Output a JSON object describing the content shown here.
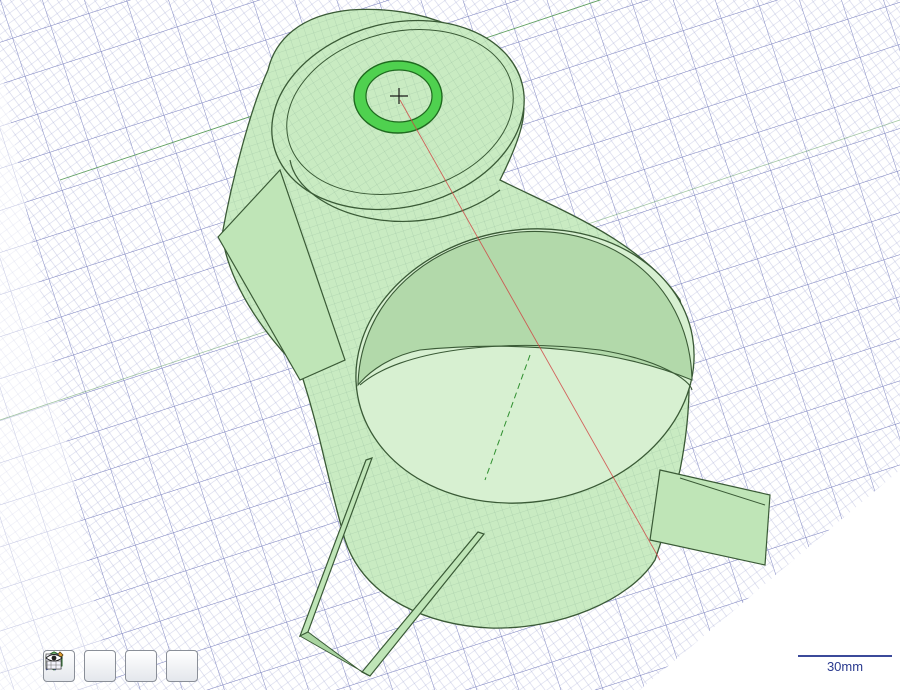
{
  "viewport": {
    "grid_color": "#8a91c7",
    "grid_major_color": "#4e59a8",
    "model_fill": "#c9ebc2",
    "model_stroke": "#3a5a36",
    "highlight_color": "#4fd14f",
    "axis_color": "#d04040",
    "background": "#ffffff"
  },
  "toolbar": {
    "buttons": [
      {
        "name": "view-cube-button",
        "icon": "green-cube-icon"
      },
      {
        "name": "sketch-edit-button",
        "icon": "pencil-grid-icon"
      },
      {
        "name": "annotation-button",
        "icon": "pen-triangle-icon"
      },
      {
        "name": "visibility-button",
        "icon": "eye-grid-icon"
      }
    ]
  },
  "scale_bar": {
    "label": "30mm"
  }
}
